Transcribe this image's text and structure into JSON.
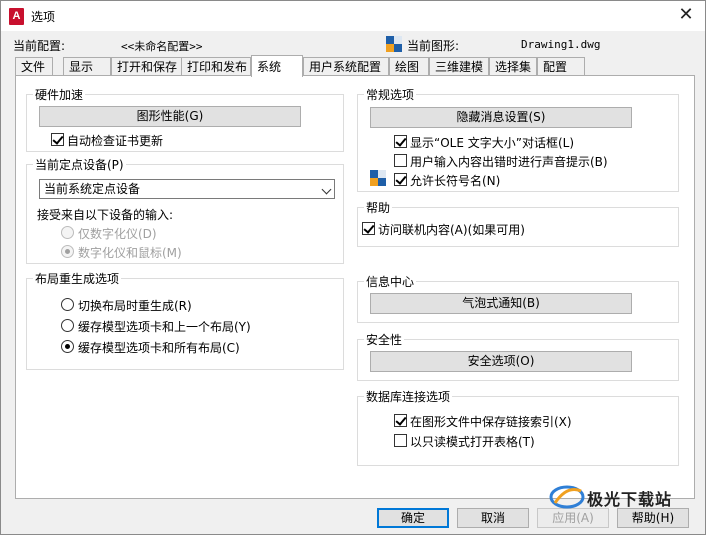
{
  "window": {
    "title": "选项",
    "close_glyph": "✕"
  },
  "profile": {
    "label": "当前配置:",
    "value": "<<未命名配置>>",
    "drawing_label": "当前图形:",
    "drawing_value": "Drawing1.dwg"
  },
  "tabs": [
    {
      "label": "文件"
    },
    {
      "label": "显示"
    },
    {
      "label": "打开和保存"
    },
    {
      "label": "打印和发布"
    },
    {
      "label": "系统"
    },
    {
      "label": "用户系统配置"
    },
    {
      "label": "绘图"
    },
    {
      "label": "三维建模"
    },
    {
      "label": "选择集"
    },
    {
      "label": "配置"
    }
  ],
  "active_tab": "系统",
  "hardware": {
    "title": "硬件加速",
    "perf_button": "图形性能(G)",
    "auto_check_label": "自动检查证书更新",
    "auto_check_checked": true
  },
  "pointing": {
    "title": "当前定点设备(P)",
    "selected": "当前系统定点设备",
    "accept_label": "接受来自以下设备的输入:",
    "opt_digitizer": "仅数字化仪(D)",
    "opt_digitizer_mouse": "数字化仪和鼠标(M)"
  },
  "layout_regen": {
    "title": "布局重生成选项",
    "opt1": "切换布局时重生成(R)",
    "opt2": "缓存模型选项卡和上一个布局(Y)",
    "opt3": "缓存模型选项卡和所有布局(C)",
    "selected": 3
  },
  "general": {
    "title": "常规选项",
    "hidden_msg_button": "隐藏消息设置(S)",
    "ole_label": "显示“OLE 文字大小”对话框(L)",
    "ole_checked": true,
    "beep_label": "用户输入内容出错时进行声音提示(B)",
    "beep_checked": false,
    "long_names_label": "允许长符号名(N)",
    "long_names_checked": true
  },
  "help": {
    "title": "帮助",
    "online_label": "访问联机内容(A)(如果可用)",
    "online_checked": true
  },
  "info_center": {
    "title": "信息中心",
    "balloon_button": "气泡式通知(B)"
  },
  "security": {
    "title": "安全性",
    "security_button": "安全选项(O)"
  },
  "db_connect": {
    "title": "数据库连接选项",
    "store_links_label": "在图形文件中保存链接索引(X)",
    "store_links_checked": true,
    "readonly_label": "以只读模式打开表格(T)",
    "readonly_checked": false
  },
  "buttons": {
    "ok": "确定",
    "cancel": "取消",
    "apply": "应用(A)",
    "help": "帮助(H)"
  },
  "watermark": {
    "text": "极光下载站"
  },
  "colors": {
    "accent": "#0078d7",
    "brand_red": "#c8102e"
  }
}
